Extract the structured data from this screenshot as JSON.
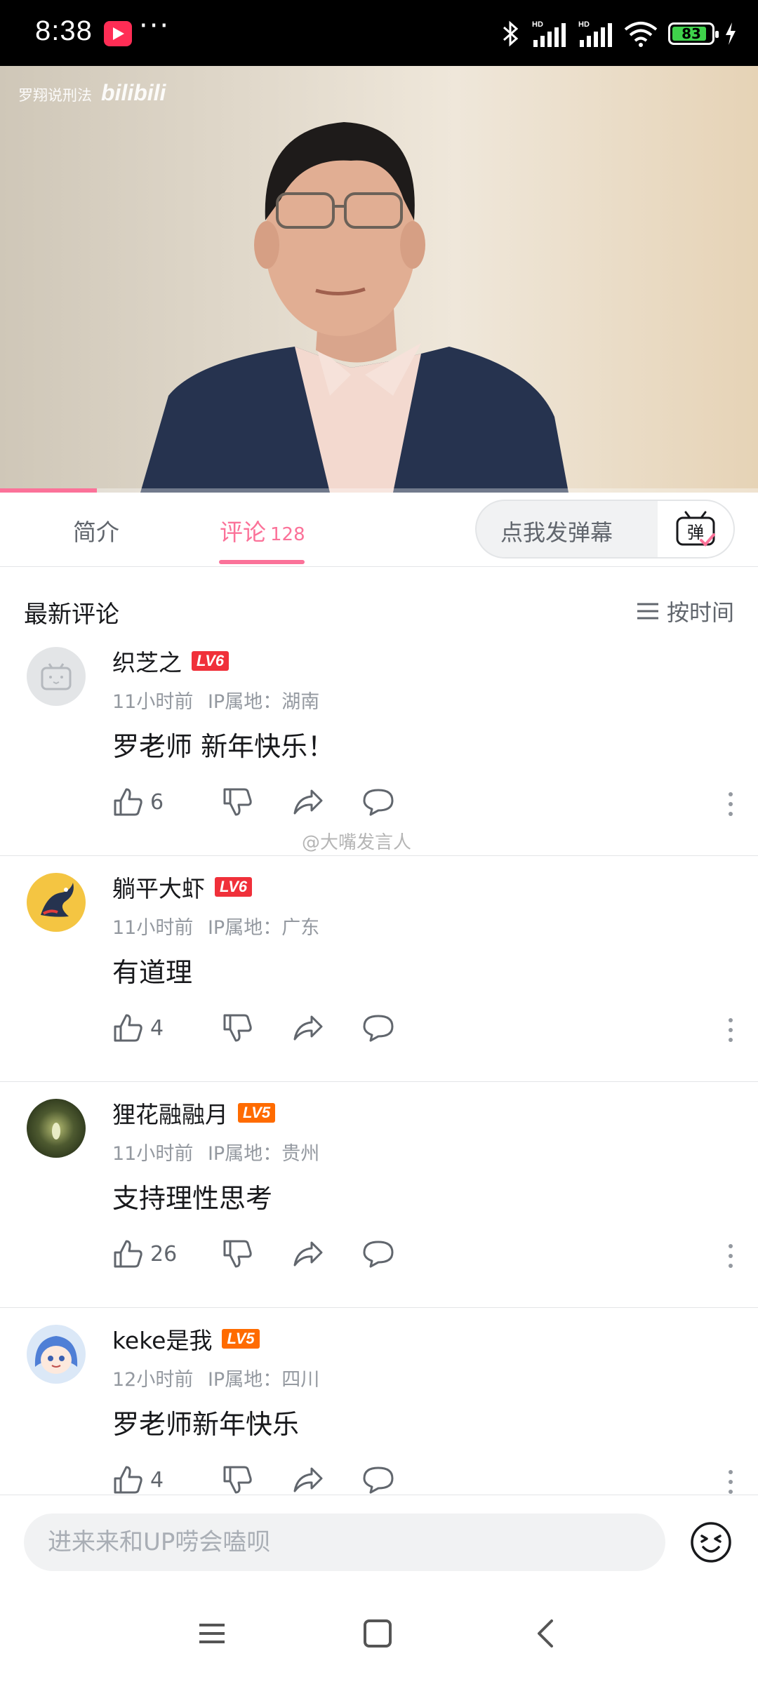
{
  "status_bar": {
    "time": "8:38",
    "dots": "···",
    "battery": "83"
  },
  "video": {
    "watermark": "罗翔说刑法",
    "logo": "bilibili",
    "progress_fraction": 0.128
  },
  "tabs": {
    "intro_label": "简介",
    "comments_label": "评论",
    "comments_count": "128",
    "danmu_placeholder": "点我发弹幕",
    "danmu_button": "弹"
  },
  "comments_header": {
    "title": "最新评论",
    "sort_label": "按时间"
  },
  "watermark_overlay": "@大嘴发言人",
  "comments": [
    {
      "name": "织芝之",
      "level": "LV6",
      "time": "11小时前",
      "ip": "IP属地：湖南",
      "text": "罗老师 新年快乐！",
      "likes": "6"
    },
    {
      "name": "躺平大虾",
      "level": "LV6",
      "time": "11小时前",
      "ip": "IP属地：广东",
      "text": "有道理",
      "likes": "4"
    },
    {
      "name": "狸花融融月",
      "level": "LV5",
      "time": "11小时前",
      "ip": "IP属地：贵州",
      "text": "支持理性思考",
      "likes": "26"
    },
    {
      "name": "keke是我",
      "level": "LV5",
      "time": "12小时前",
      "ip": "IP属地：四川",
      "text": "罗老师新年快乐",
      "likes": "4"
    }
  ],
  "input": {
    "placeholder": "进来来和UP唠会嗑呗"
  },
  "colors": {
    "accent": "#fb7299",
    "lv6": "#f0303a",
    "lv5": "#ff6b00"
  }
}
